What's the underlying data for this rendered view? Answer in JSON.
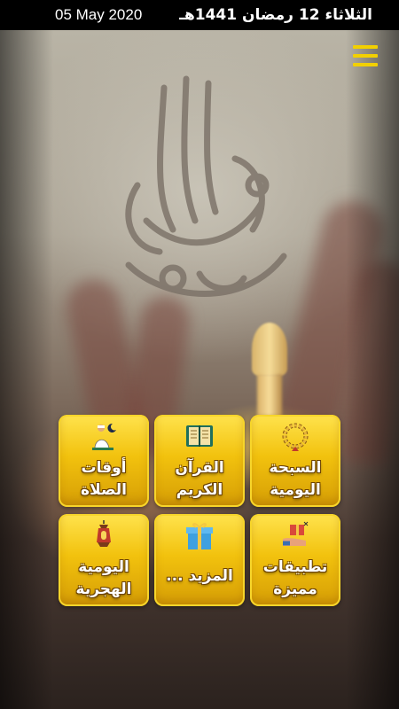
{
  "status_bar": {
    "gregorian_date": "05 May 2020",
    "hijri_date": "الثلاثاء 12 رمضان 1441هـ"
  },
  "menu": {
    "icon": "hamburger-menu-icon",
    "color": "#f2d000"
  },
  "tiles": [
    {
      "id": "tasbeeh",
      "line1": "السبحة",
      "line2": "اليومية",
      "icon": "prayer-beads-icon"
    },
    {
      "id": "quran",
      "line1": "القرآن",
      "line2": "الكريم",
      "icon": "quran-book-icon"
    },
    {
      "id": "prayer-times",
      "line1": "أوقات",
      "line2": "الصلاة",
      "icon": "praying-man-icon"
    },
    {
      "id": "featured-apps",
      "line1": "تطبيقات",
      "line2": "مميزة",
      "icon": "gift-hand-icon"
    },
    {
      "id": "more",
      "line1": "المزيد ...",
      "line2": "",
      "icon": "gift-box-icon"
    },
    {
      "id": "hijri-calendar",
      "line1": "اليومية",
      "line2": "الهجرية",
      "icon": "lantern-icon"
    }
  ],
  "colors": {
    "tile_gold": "#f2c20e",
    "tile_text": "#ffffff",
    "topbar": "#000000"
  }
}
